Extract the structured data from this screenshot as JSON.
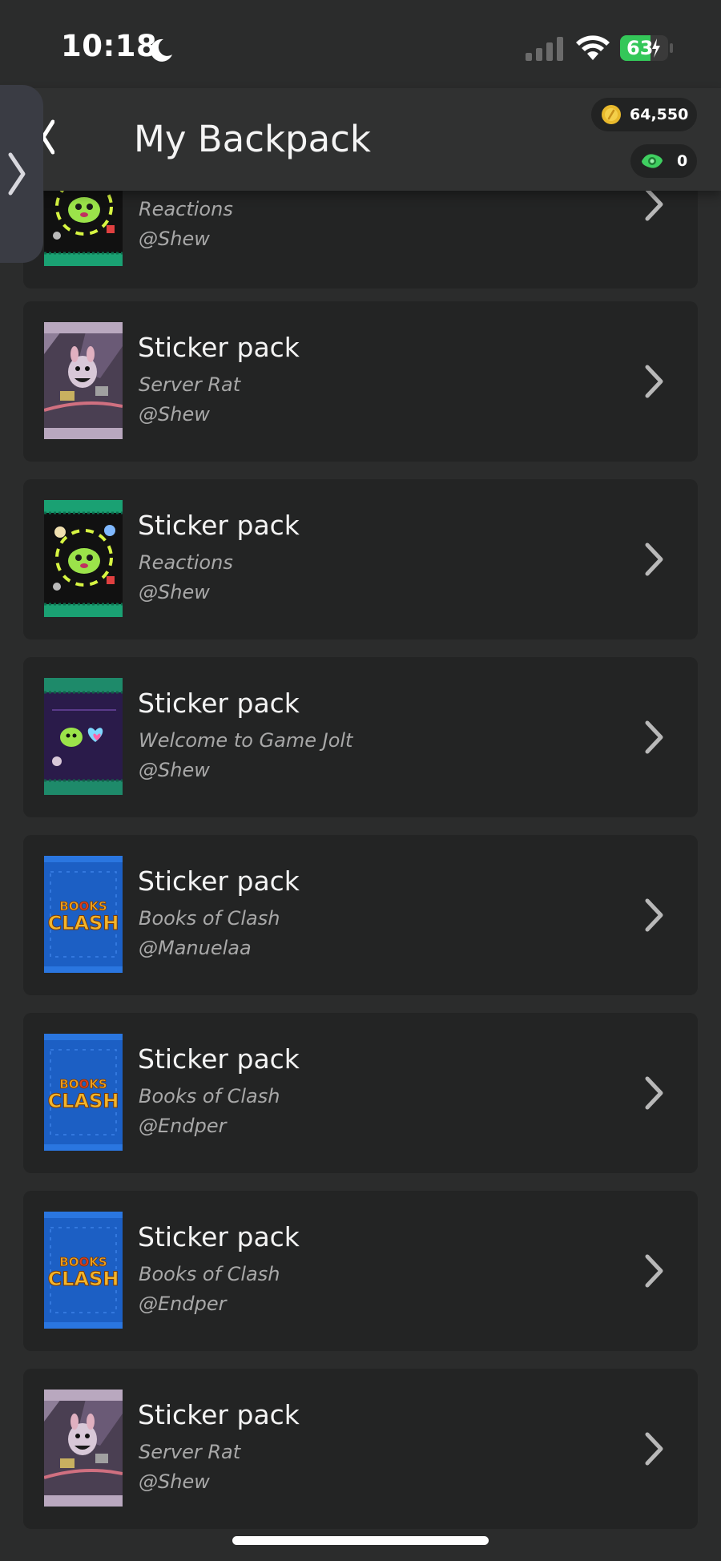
{
  "status_bar": {
    "time": "10:18",
    "battery": "63"
  },
  "header": {
    "title": "My Backpack",
    "coins": "64,550",
    "joltbux": "0"
  },
  "packs": [
    {
      "title": "",
      "subtitle": "Reactions",
      "author": "@Shew",
      "art": "reactions"
    },
    {
      "title": "Sticker pack",
      "subtitle": "Server Rat",
      "author": "@Shew",
      "art": "server-rat"
    },
    {
      "title": "Sticker pack",
      "subtitle": "Reactions",
      "author": "@Shew",
      "art": "reactions"
    },
    {
      "title": "Sticker pack",
      "subtitle": "Welcome to Game Jolt",
      "author": "@Shew",
      "art": "welcome"
    },
    {
      "title": "Sticker pack",
      "subtitle": "Books of Clash",
      "author": "@Manuelaa",
      "art": "books-of-clash"
    },
    {
      "title": "Sticker pack",
      "subtitle": "Books of Clash",
      "author": "@Endper",
      "art": "books-of-clash"
    },
    {
      "title": "Sticker pack",
      "subtitle": "Books of Clash",
      "author": "@Endper",
      "art": "books-of-clash"
    },
    {
      "title": "Sticker pack",
      "subtitle": "Server Rat",
      "author": "@Shew",
      "art": "server-rat"
    }
  ],
  "pack_art_text": {
    "books_of_clash": "BOOKS CLASH"
  },
  "colors": {
    "background": "#2b2c2c",
    "card": "#232424",
    "coin": "#e8b92c",
    "joltbux": "#3fcf60",
    "battery": "#34c759"
  }
}
